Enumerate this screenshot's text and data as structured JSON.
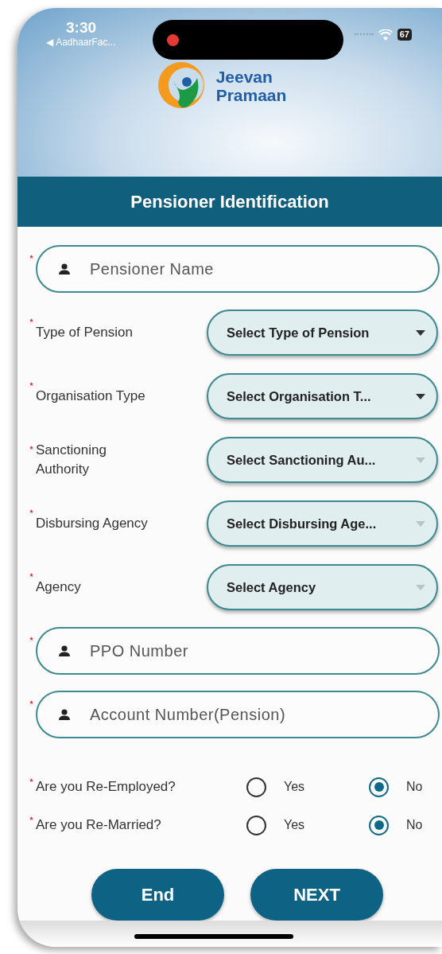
{
  "status_bar": {
    "time": "3:30",
    "back_app": "◀ AadhaarFac...",
    "battery": "67"
  },
  "logo": {
    "line1": "Jeevan",
    "line2": "Pramaan"
  },
  "header": {
    "title": "Pensioner Identification"
  },
  "form": [
    {
      "kind": "text_field",
      "required": true,
      "placeholder": "Pensioner Name"
    },
    {
      "kind": "dropdown",
      "required": true,
      "label": "Type of Pension",
      "placeholder": "Select Type of Pension",
      "disabled": false
    },
    {
      "kind": "dropdown",
      "required": true,
      "label": "Organisation Type",
      "placeholder": "Select Organisation T...",
      "disabled": false
    },
    {
      "kind": "dropdown",
      "required": true,
      "label": "Sanctioning Authority",
      "placeholder": "Select Sanctioning Au...",
      "disabled": true
    },
    {
      "kind": "dropdown",
      "required": true,
      "label": "Disbursing Agency",
      "placeholder": "Select Disbursing Age...",
      "disabled": true
    },
    {
      "kind": "dropdown",
      "required": true,
      "label": "Agency",
      "placeholder": "Select Agency",
      "disabled": true
    },
    {
      "kind": "text_field",
      "required": true,
      "placeholder": "PPO Number"
    },
    {
      "kind": "text_field",
      "required": true,
      "placeholder": "Account Number(Pension)"
    }
  ],
  "questions": [
    {
      "required": true,
      "label": "Are you Re-Employed?",
      "options": [
        {
          "label": "Yes",
          "selected": false
        },
        {
          "label": "No",
          "selected": true
        }
      ]
    },
    {
      "required": true,
      "label": "Are you Re-Married?",
      "options": [
        {
          "label": "Yes",
          "selected": false
        },
        {
          "label": "No",
          "selected": true
        }
      ]
    }
  ],
  "buttons": [
    {
      "label": "End"
    },
    {
      "label": "NEXT"
    }
  ]
}
